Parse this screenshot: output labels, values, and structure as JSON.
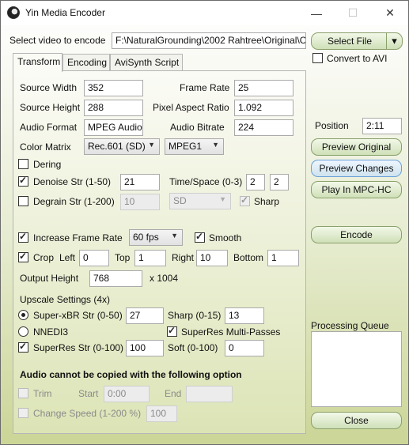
{
  "window": {
    "title": "Yin Media Encoder",
    "minimize": "—",
    "maximize": "☐",
    "close": "✕"
  },
  "top": {
    "select_label": "Select video to encode",
    "file_path": "F:\\NaturalGrounding\\2002 Rahtree\\Original\\C",
    "select_file_button": "Select File",
    "dropdown_arrow": "▾",
    "convert_avi_label": "Convert to AVI",
    "convert_avi_checked": false
  },
  "tabs": [
    {
      "label": "Transform",
      "active": true
    },
    {
      "label": "Encoding",
      "active": false
    },
    {
      "label": "AviSynth Script",
      "active": false
    }
  ],
  "transform": {
    "source_width_label": "Source Width",
    "source_width": "352",
    "frame_rate_label": "Frame Rate",
    "frame_rate": "25",
    "source_height_label": "Source Height",
    "source_height": "288",
    "par_label": "Pixel Aspect Ratio",
    "par": "1.092",
    "audio_format_label": "Audio Format",
    "audio_format": "MPEG Audio",
    "audio_bitrate_label": "Audio Bitrate",
    "audio_bitrate": "224",
    "color_matrix_label": "Color Matrix",
    "color_matrix": "Rec.601 (SD)",
    "mpeg_type": "MPEG1",
    "dering_label": "Dering",
    "dering_checked": false,
    "denoise_label": "Denoise Str (1-50)",
    "denoise_checked": true,
    "denoise_value": "21",
    "timespace_label": "Time/Space (0-3)",
    "time_value": "2",
    "space_value": "2",
    "degrain_label": "Degrain Str (1-200)",
    "degrain_checked": false,
    "degrain_value": "10",
    "degrain_mode": "SD",
    "sharp_label": "Sharp",
    "sharp_checked": true,
    "increase_fr_label": "Increase Frame Rate",
    "increase_fr_checked": true,
    "fps_value": "60 fps",
    "smooth_label": "Smooth",
    "smooth_checked": true,
    "crop_label": "Crop",
    "crop_checked": true,
    "left_label": "Left",
    "left_value": "0",
    "top_label": "Top",
    "top_value": "1",
    "right_label": "Right",
    "right_value": "10",
    "bottom_label": "Bottom",
    "bottom_value": "1",
    "output_height_label": "Output Height",
    "output_height": "768",
    "output_width_text": "x 1004",
    "upscale_label": "Upscale Settings (4x)",
    "superxbr_label": "Super-xBR Str (0-50)",
    "superxbr_selected": true,
    "superxbr_value": "27",
    "sharp015_label": "Sharp (0-15)",
    "sharp015_value": "13",
    "nnedi3_label": "NNEDI3",
    "nnedi3_selected": false,
    "superres_multi_label": "SuperRes Multi-Passes",
    "superres_multi_checked": true,
    "superres_str_label": "SuperRes Str (0-100)",
    "superres_str_checked": true,
    "superres_str_value": "100",
    "soft_label": "Soft (0-100)",
    "soft_value": "0",
    "audio_warning": "Audio cannot be copied with the following option",
    "trim_label": "Trim",
    "trim_checked": false,
    "start_label": "Start",
    "start_value": "0:00",
    "end_label": "End",
    "end_value": "",
    "change_speed_label": "Change Speed (1-200 %)",
    "change_speed_checked": false,
    "change_speed_value": "100"
  },
  "right_panel": {
    "position_label": "Position",
    "position_value": "2:11",
    "preview_original": "Preview Original",
    "preview_changes": "Preview Changes",
    "play_mpc": "Play In MPC-HC",
    "encode": "Encode",
    "processing_queue_label": "Processing Queue",
    "close": "Close"
  }
}
